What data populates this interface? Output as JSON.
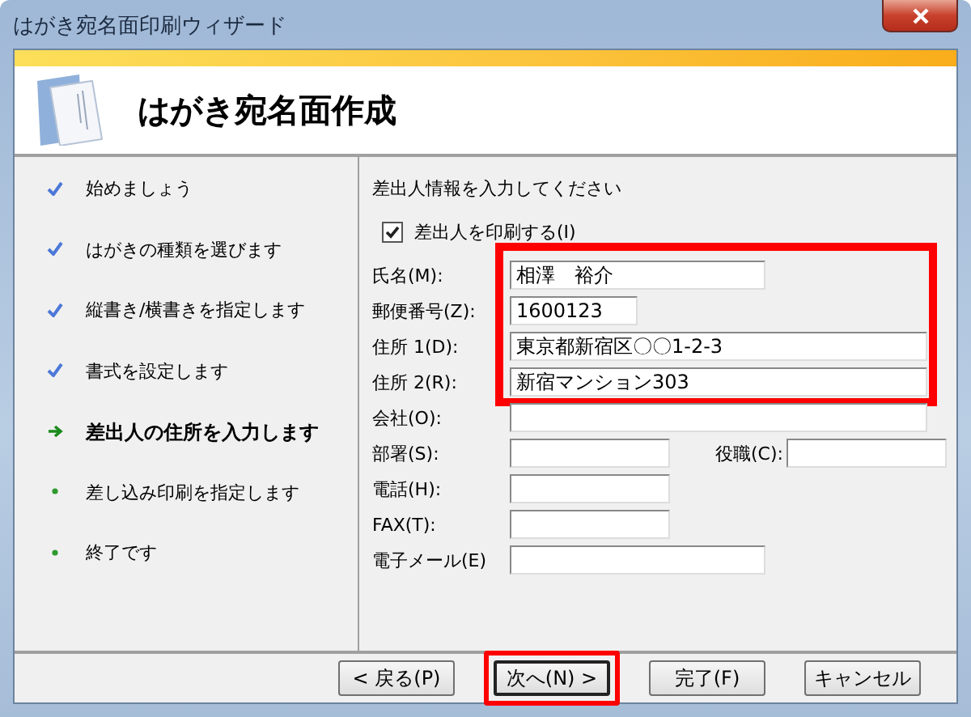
{
  "window": {
    "title": "はがき宛名面印刷ウィザード"
  },
  "header": {
    "title": "はがき宛名面作成"
  },
  "steps": [
    {
      "label": "始めましょう",
      "kind": "done"
    },
    {
      "label": "はがきの種類を選びます",
      "kind": "done"
    },
    {
      "label": "縦書き/横書きを指定します",
      "kind": "done"
    },
    {
      "label": "書式を設定します",
      "kind": "done"
    },
    {
      "label": "差出人の住所を入力します",
      "kind": "current"
    },
    {
      "label": "差し込み印刷を指定します",
      "kind": "pending"
    },
    {
      "label": "終了です",
      "kind": "pending"
    }
  ],
  "form": {
    "heading": "差出人情報を入力してください",
    "print_sender": {
      "label": "差出人を印刷する(I)",
      "checked": true
    },
    "rows": [
      {
        "highlighted": true,
        "fields": [
          {
            "label": "氏名(M):",
            "value": "相澤　裕介"
          }
        ]
      },
      {
        "highlighted": true,
        "fields": [
          {
            "label": "郵便番号(Z):",
            "value": "1600123"
          }
        ]
      },
      {
        "highlighted": true,
        "fields": [
          {
            "label": "住所 1(D):",
            "value": "東京都新宿区〇〇1-2-3"
          }
        ]
      },
      {
        "highlighted": true,
        "fields": [
          {
            "label": "住所 2(R):",
            "value": "新宿マンション303"
          }
        ]
      },
      {
        "highlighted": false,
        "fields": [
          {
            "label": "会社(O):"
          }
        ]
      },
      {
        "highlighted": false,
        "fields": [
          {
            "label": "部署(S):"
          },
          {
            "label": "役職(C):"
          }
        ]
      },
      {
        "highlighted": false,
        "fields": [
          {
            "label": "電話(H):"
          }
        ]
      },
      {
        "highlighted": false,
        "fields": [
          {
            "label": "FAX(T):"
          }
        ]
      },
      {
        "highlighted": false,
        "fields": [
          {
            "label": "電子メール(E)"
          }
        ]
      }
    ]
  },
  "buttons": [
    {
      "label": "< 戻る(P)",
      "highlighted": false
    },
    {
      "label": "次へ(N) >",
      "highlighted": true
    },
    {
      "label": "完了(F)",
      "highlighted": false
    },
    {
      "label": "キャンセル",
      "highlighted": false
    }
  ]
}
